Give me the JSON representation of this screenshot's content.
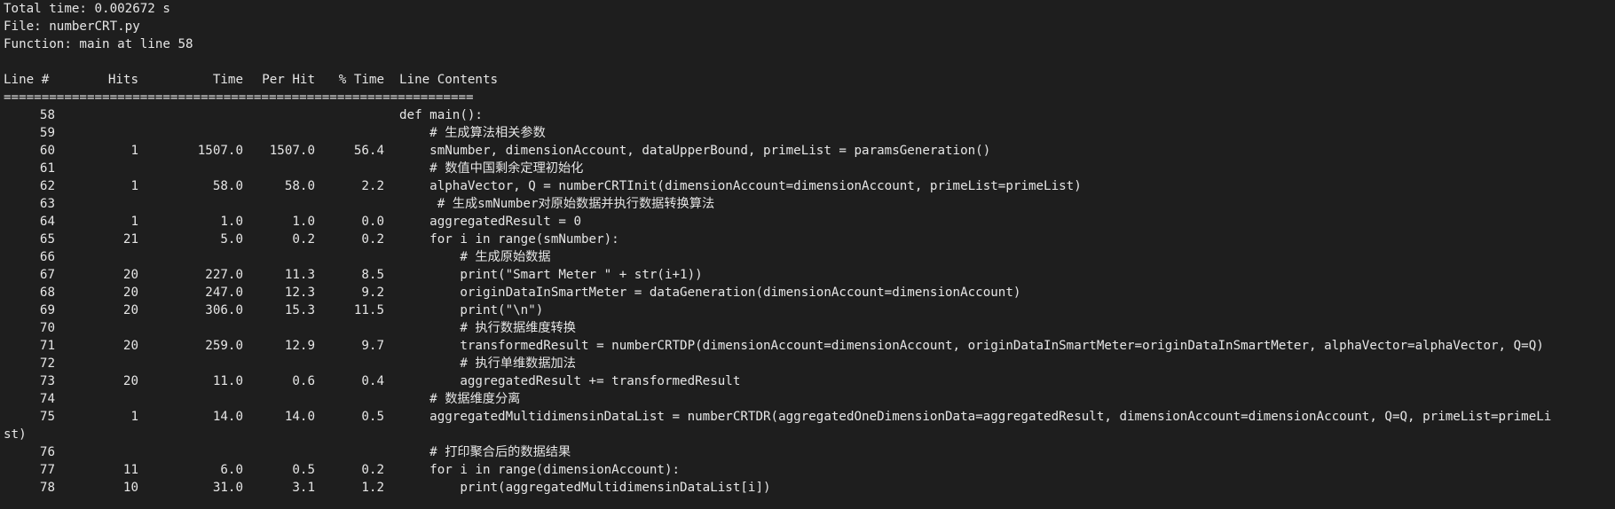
{
  "summary": {
    "total_time": "Total time: 0.002672 s",
    "file": "File: numberCRT.py",
    "function": "Function: main at line 58"
  },
  "header": {
    "line": "Line #",
    "hits": "Hits",
    "time": "Time",
    "per_hit": "Per Hit",
    "pct_time": "% Time",
    "contents": "Line Contents"
  },
  "separator": "==============================================================",
  "rows": [
    {
      "line": "58",
      "hits": "",
      "time": "",
      "per_hit": "",
      "pct": "",
      "content": "def main():"
    },
    {
      "line": "59",
      "hits": "",
      "time": "",
      "per_hit": "",
      "pct": "",
      "content": "    # 生成算法相关参数"
    },
    {
      "line": "60",
      "hits": "1",
      "time": "1507.0",
      "per_hit": "1507.0",
      "pct": "56.4",
      "content": "    smNumber, dimensionAccount, dataUpperBound, primeList = paramsGeneration()"
    },
    {
      "line": "61",
      "hits": "",
      "time": "",
      "per_hit": "",
      "pct": "",
      "content": "    # 数值中国剩余定理初始化"
    },
    {
      "line": "62",
      "hits": "1",
      "time": "58.0",
      "per_hit": "58.0",
      "pct": "2.2",
      "content": "    alphaVector, Q = numberCRTInit(dimensionAccount=dimensionAccount, primeList=primeList)"
    },
    {
      "line": "63",
      "hits": "",
      "time": "",
      "per_hit": "",
      "pct": "",
      "content": "     # 生成smNumber对原始数据并执行数据转换算法"
    },
    {
      "line": "64",
      "hits": "1",
      "time": "1.0",
      "per_hit": "1.0",
      "pct": "0.0",
      "content": "    aggregatedResult = 0"
    },
    {
      "line": "65",
      "hits": "21",
      "time": "5.0",
      "per_hit": "0.2",
      "pct": "0.2",
      "content": "    for i in range(smNumber):"
    },
    {
      "line": "66",
      "hits": "",
      "time": "",
      "per_hit": "",
      "pct": "",
      "content": "        # 生成原始数据"
    },
    {
      "line": "67",
      "hits": "20",
      "time": "227.0",
      "per_hit": "11.3",
      "pct": "8.5",
      "content": "        print(\"Smart Meter \" + str(i+1))"
    },
    {
      "line": "68",
      "hits": "20",
      "time": "247.0",
      "per_hit": "12.3",
      "pct": "9.2",
      "content": "        originDataInSmartMeter = dataGeneration(dimensionAccount=dimensionAccount)"
    },
    {
      "line": "69",
      "hits": "20",
      "time": "306.0",
      "per_hit": "15.3",
      "pct": "11.5",
      "content": "        print(\"\\n\")"
    },
    {
      "line": "70",
      "hits": "",
      "time": "",
      "per_hit": "",
      "pct": "",
      "content": "        # 执行数据维度转换"
    },
    {
      "line": "71",
      "hits": "20",
      "time": "259.0",
      "per_hit": "12.9",
      "pct": "9.7",
      "content": "        transformedResult = numberCRTDP(dimensionAccount=dimensionAccount, originDataInSmartMeter=originDataInSmartMeter, alphaVector=alphaVector, Q=Q)"
    },
    {
      "line": "72",
      "hits": "",
      "time": "",
      "per_hit": "",
      "pct": "",
      "content": "        # 执行单维数据加法"
    },
    {
      "line": "73",
      "hits": "20",
      "time": "11.0",
      "per_hit": "0.6",
      "pct": "0.4",
      "content": "        aggregatedResult += transformedResult"
    },
    {
      "line": "74",
      "hits": "",
      "time": "",
      "per_hit": "",
      "pct": "",
      "content": "    # 数据维度分离"
    },
    {
      "line": "75",
      "hits": "1",
      "time": "14.0",
      "per_hit": "14.0",
      "pct": "0.5",
      "content": "    aggregatedMultidimensinDataList = numberCRTDR(aggregatedOneDimensionData=aggregatedResult, dimensionAccount=dimensionAccount, Q=Q, primeList=primeLi"
    }
  ],
  "wrap_tail": "st)",
  "rows_after": [
    {
      "line": "76",
      "hits": "",
      "time": "",
      "per_hit": "",
      "pct": "",
      "content": "    # 打印聚合后的数据结果"
    },
    {
      "line": "77",
      "hits": "11",
      "time": "6.0",
      "per_hit": "0.5",
      "pct": "0.2",
      "content": "    for i in range(dimensionAccount):"
    },
    {
      "line": "78",
      "hits": "10",
      "time": "31.0",
      "per_hit": "3.1",
      "pct": "1.2",
      "content": "        print(aggregatedMultidimensinDataList[i])"
    }
  ],
  "colors": {
    "background": "#1e1e1e",
    "text": "#e6e6e6"
  }
}
